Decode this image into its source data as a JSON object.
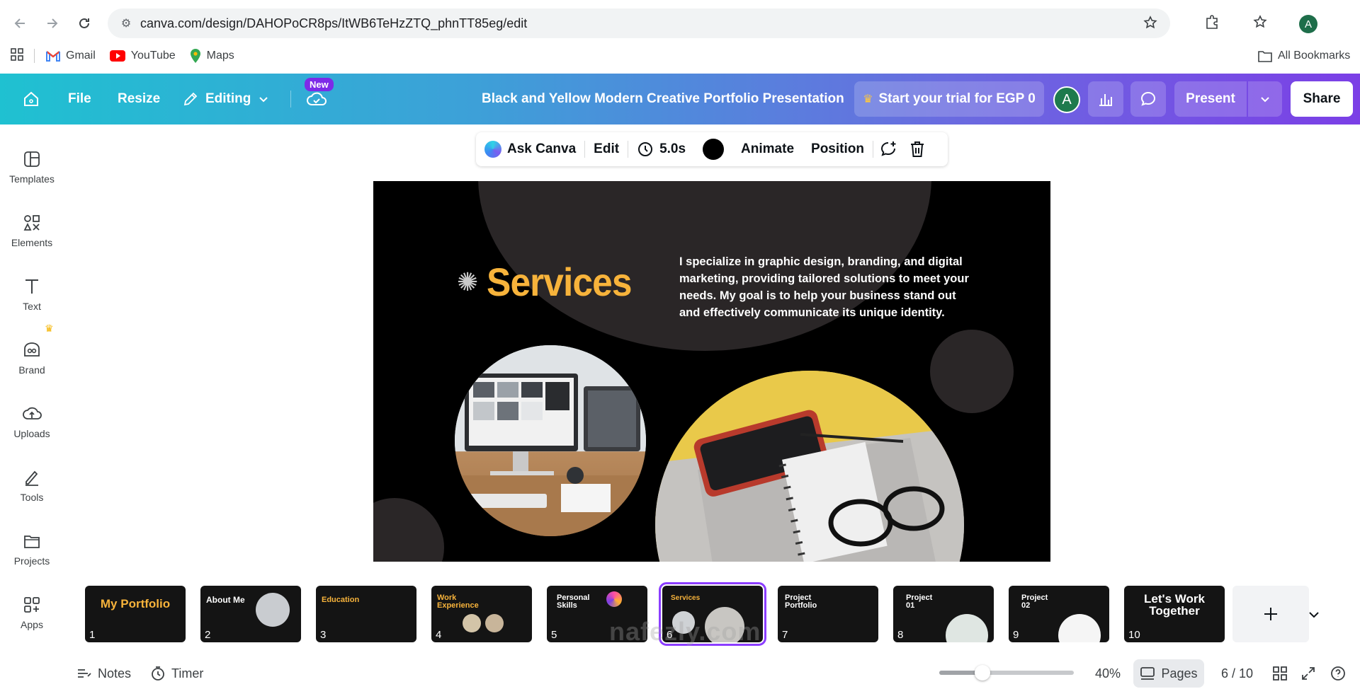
{
  "browser": {
    "url": "canva.com/design/DAHOPoCR8ps/ItWB6TeHzZTQ_phnTT85eg/edit",
    "profile_initial": "A",
    "bookmarks": [
      {
        "label": "Gmail",
        "icon": "gmail-icon"
      },
      {
        "label": "YouTube",
        "icon": "youtube-icon"
      },
      {
        "label": "Maps",
        "icon": "maps-icon"
      }
    ],
    "all_bookmarks": "All Bookmarks"
  },
  "header": {
    "file": "File",
    "resize": "Resize",
    "editing": "Editing",
    "new_badge": "New",
    "doc_title": "Black and Yellow Modern Creative Portfolio Presentation",
    "trial": "Start your trial for EGP 0",
    "avatar": "A",
    "present": "Present",
    "share": "Share"
  },
  "sidebar": {
    "items": [
      {
        "label": "Templates",
        "icon": "templates-icon"
      },
      {
        "label": "Elements",
        "icon": "elements-icon"
      },
      {
        "label": "Text",
        "icon": "text-icon"
      },
      {
        "label": "Brand",
        "icon": "brand-icon"
      },
      {
        "label": "Uploads",
        "icon": "uploads-icon"
      },
      {
        "label": "Tools",
        "icon": "tools-icon"
      },
      {
        "label": "Projects",
        "icon": "projects-icon"
      },
      {
        "label": "Apps",
        "icon": "apps-icon"
      }
    ]
  },
  "toolbar": {
    "ask": "Ask Canva",
    "edit": "Edit",
    "duration": "5.0s",
    "animate": "Animate",
    "position": "Position"
  },
  "slide": {
    "title": "Services",
    "body": "I specialize in graphic design, branding, and digital marketing, providing tailored solutions to meet your needs. My goal is to help your business stand out and effectively communicate its unique identity.",
    "accent": "#f7b33b"
  },
  "thumbnails": [
    {
      "num": "1",
      "title": "My Portfolio",
      "active": false
    },
    {
      "num": "2",
      "title": "About Me",
      "active": false
    },
    {
      "num": "3",
      "title": "Education",
      "active": false
    },
    {
      "num": "4",
      "title": "Work Experience",
      "active": false
    },
    {
      "num": "5",
      "title": "Personal Skills",
      "active": false
    },
    {
      "num": "6",
      "title": "Services",
      "active": true
    },
    {
      "num": "7",
      "title": "Project Portfolio",
      "active": false
    },
    {
      "num": "8",
      "title": "Project 01",
      "active": false
    },
    {
      "num": "9",
      "title": "Project 02",
      "active": false
    },
    {
      "num": "10",
      "title": "Let's Work Together",
      "active": false
    }
  ],
  "bottom": {
    "notes": "Notes",
    "timer": "Timer",
    "zoom": "40%",
    "zoom_fraction": 0.32,
    "pages": "Pages",
    "page_counter": "6 / 10"
  },
  "watermark": "nafezly.com",
  "colors": {
    "brand_purple": "#8b3dff",
    "accent_yellow": "#f7b33b"
  }
}
